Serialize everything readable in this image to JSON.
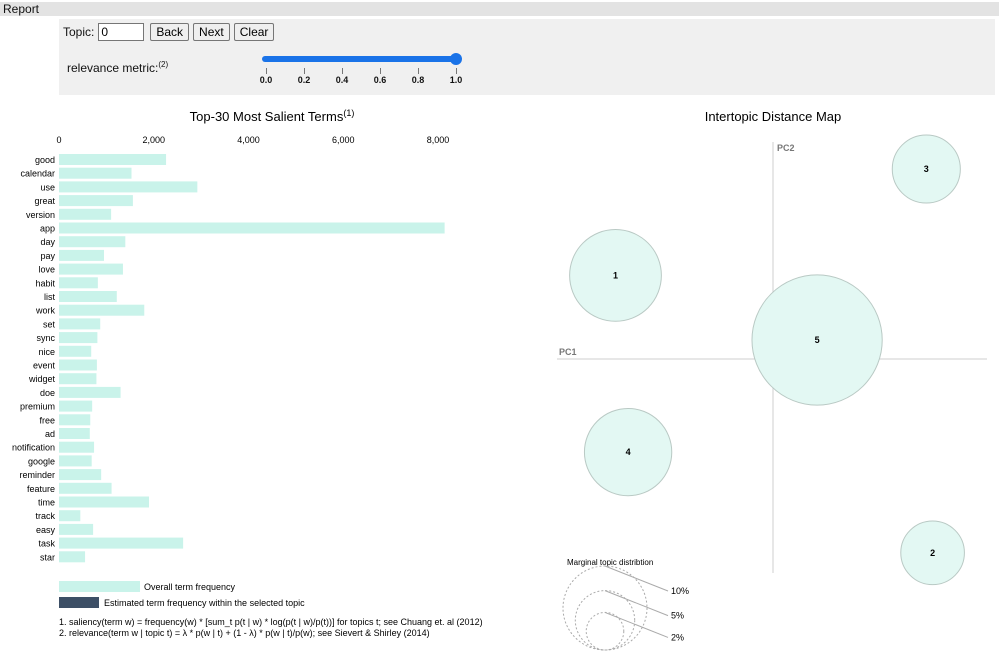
{
  "header": {
    "title": "Report"
  },
  "controls": {
    "topic_label": "Topic:",
    "topic_value": "0",
    "back_label": "Back",
    "next_label": "Next",
    "clear_label": "Clear",
    "relevance_label": "relevance metric:",
    "relevance_sup": "(2)",
    "lambda_value": 1.0,
    "slider_ticks": [
      "0.0",
      "0.2",
      "0.4",
      "0.6",
      "0.8",
      "1.0"
    ]
  },
  "chart_data": [
    {
      "type": "bar",
      "title": "Top-30 Most Salient Terms",
      "title_sup": "(1)",
      "orientation": "horizontal",
      "xlim": [
        0,
        8000
      ],
      "x_ticks": [
        "0",
        "2,000",
        "4,000",
        "6,000",
        "8,000"
      ],
      "x_tick_values": [
        0,
        2000,
        4000,
        6000,
        8000
      ],
      "categories": [
        "good",
        "calendar",
        "use",
        "great",
        "version",
        "app",
        "day",
        "pay",
        "love",
        "habit",
        "list",
        "work",
        "set",
        "sync",
        "nice",
        "event",
        "widget",
        "doe",
        "premium",
        "free",
        "ad",
        "notification",
        "google",
        "reminder",
        "feature",
        "time",
        "track",
        "easy",
        "task",
        "star"
      ],
      "series": [
        {
          "name": "Overall term frequency",
          "color": "#c9f3ea",
          "values": [
            2260,
            1530,
            2920,
            1560,
            1100,
            8140,
            1400,
            950,
            1350,
            820,
            1220,
            1800,
            870,
            810,
            680,
            800,
            790,
            1300,
            700,
            660,
            650,
            740,
            690,
            890,
            1110,
            1900,
            450,
            720,
            2620,
            550
          ]
        }
      ],
      "legend": [
        {
          "label": "Overall term frequency",
          "color": "#c9f3ea"
        },
        {
          "label": "Estimated term frequency within the selected topic",
          "color": "#3d4f66"
        }
      ],
      "footnotes": [
        "1. saliency(term w) = frequency(w) * [sum_t p(t | w) * log(p(t | w)/p(t))] for topics t; see Chuang et. al (2012)",
        "2. relevance(term w | topic t) = λ * p(w | t) + (1 - λ) * p(w | t)/p(w); see Sievert & Shirley (2014)"
      ]
    },
    {
      "type": "scatter",
      "title": "Intertopic Distance Map",
      "xlabel": "PC1",
      "ylabel": "PC2",
      "xlim": [
        -1,
        1
      ],
      "ylim": [
        -1,
        1
      ],
      "topics": [
        {
          "label": "1",
          "x": -0.75,
          "y": 0.44,
          "size": 6.2
        },
        {
          "label": "2",
          "x": 0.76,
          "y": -1.02,
          "size": 4.3
        },
        {
          "label": "3",
          "x": 0.73,
          "y": 1.0,
          "size": 4.6
        },
        {
          "label": "4",
          "x": -0.69,
          "y": -0.49,
          "size": 5.9
        },
        {
          "label": "5",
          "x": 0.21,
          "y": 0.1,
          "size": 8.8
        }
      ],
      "circle_color": "#e3f8f3",
      "marginal": {
        "title": "Marginal topic distribtion",
        "levels": [
          {
            "label": "2%",
            "value": 2
          },
          {
            "label": "5%",
            "value": 5
          },
          {
            "label": "10%",
            "value": 10
          }
        ]
      }
    }
  ]
}
